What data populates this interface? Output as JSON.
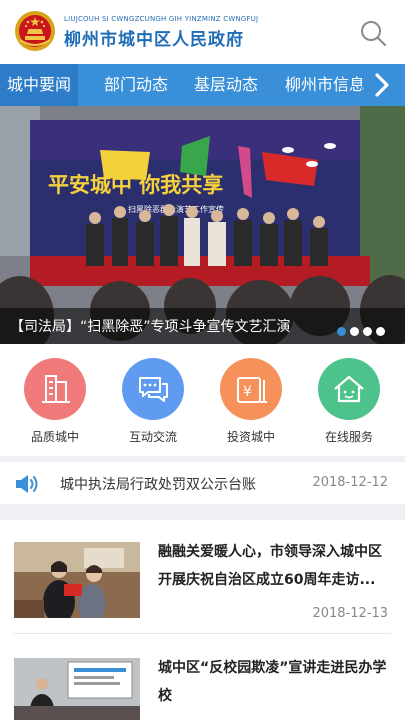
{
  "header": {
    "subtitle": "LIUJCOUH SI CWNGZCUNGH GIH YINZMINZ CWNGFUJ",
    "title": "柳州市城中区人民政府"
  },
  "nav": {
    "tabs": [
      {
        "label": "城中要闻",
        "active": true
      },
      {
        "label": "部门动态",
        "active": false
      },
      {
        "label": "基层动态",
        "active": false
      },
      {
        "label": "柳州市信息",
        "active": false
      }
    ]
  },
  "banner": {
    "caption": "【司法局】“扫黑除恶”专项斗争宣传文艺汇演",
    "backdrop_text": "平安城中  你我共享",
    "backdrop_sub": "扫黑除恶群众演艺工作宣传",
    "slide_count": 4,
    "active_slide": 1
  },
  "quick_links": [
    {
      "label": "品质城中",
      "icon": "building-icon",
      "color": "#f07a7a"
    },
    {
      "label": "互动交流",
      "icon": "chat-icon",
      "color": "#5f9bf0"
    },
    {
      "label": "投资城中",
      "icon": "money-icon",
      "color": "#f7915c"
    },
    {
      "label": "在线服务",
      "icon": "house-icon",
      "color": "#4ec28b"
    }
  ],
  "notice": {
    "icon": "speaker-icon",
    "text": "城中执法局行政处罚双公示台账",
    "date": "2018-12-12"
  },
  "news": [
    {
      "title": "融融关爱暖人心，市领导深入城中区开展庆祝自治区成立60周年走访...",
      "date": "2018-12-13"
    },
    {
      "title": "城中区“反校园欺凌”宣讲走进民办学校",
      "date": ""
    }
  ],
  "colors": {
    "brand_blue": "#3a8fd9",
    "title_blue": "#1f6db5",
    "active_dot": "#3a8fd9"
  }
}
